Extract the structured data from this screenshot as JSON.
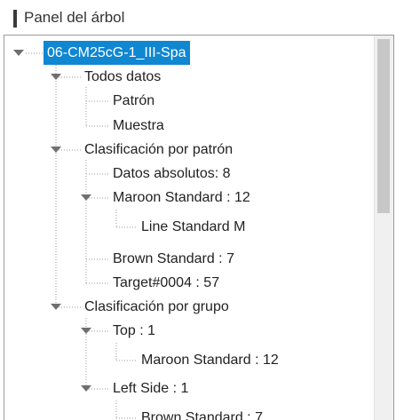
{
  "panel": {
    "title": "Panel del árbol"
  },
  "tree": {
    "root": "06-CM25cG-1_III-Spa",
    "todos_datos": "Todos datos",
    "patron": "Patrón",
    "muestra": "Muestra",
    "clasif_patron": "Clasificación por patrón",
    "datos_absolutos": "Datos absolutos: 8",
    "maroon_standard": "Maroon Standard : 12",
    "line_standard_m": "Line Standard M",
    "brown_standard": "Brown Standard : 7",
    "target": "Target#0004 : 57",
    "clasif_grupo": "Clasificación por grupo",
    "top": "Top : 1",
    "top_maroon": "Maroon Standard : 12",
    "left_side": "Left Side : 1",
    "left_brown": "Brown Standard : 7"
  },
  "colors": {
    "selection": "#0f87d1",
    "tree_line": "#9a9a9a",
    "expander": "#6f6f6f"
  }
}
